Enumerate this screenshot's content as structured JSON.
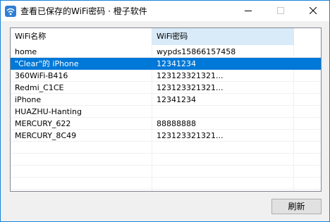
{
  "window": {
    "title": "查看已保存的WiFi密码 · 橙子软件",
    "app_icon": "wifi-icon",
    "controls": [
      "minimize-icon",
      "maximize-icon",
      "close-icon"
    ]
  },
  "table": {
    "headers": [
      "WiFi名称",
      "WiFi密码"
    ],
    "rows": [
      {
        "name": "home",
        "password": "wypds15866157458"
      },
      {
        "name": "\"Clear\"的 iPhone",
        "password": "12341234"
      },
      {
        "name": "360WiFi-B416",
        "password": "123123321321..."
      },
      {
        "name": "Redmi_C1CE",
        "password": "123123321321..."
      },
      {
        "name": "iPhone",
        "password": "12341234"
      },
      {
        "name": "HUAZHU-Hanting",
        "password": ""
      },
      {
        "name": "MERCURY_622",
        "password": "88888888"
      },
      {
        "name": "MERCURY_8C49",
        "password": "123123321321..."
      }
    ],
    "selected_row_index": 1,
    "empty_row_count": 4
  },
  "buttons": {
    "refresh": "刷新"
  },
  "colors": {
    "selection": "#0078d7",
    "sorted_header": "#d9ebf9",
    "window_border": "#1883d7"
  }
}
